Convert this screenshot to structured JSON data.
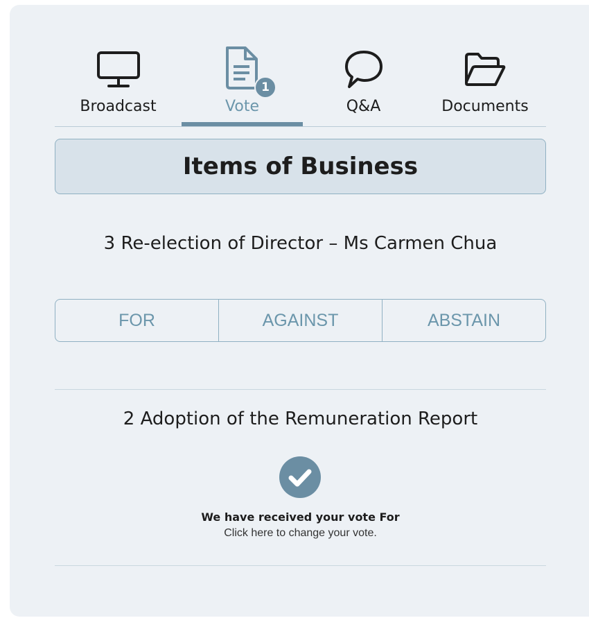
{
  "tabs": [
    {
      "label": "Broadcast",
      "icon": "monitor-icon"
    },
    {
      "label": "Vote",
      "icon": "document-icon",
      "badge": "1",
      "active": true
    },
    {
      "label": "Q&A",
      "icon": "speech-bubble-icon"
    },
    {
      "label": "Documents",
      "icon": "folder-icon"
    }
  ],
  "header": {
    "title": "Items of Business"
  },
  "item_current": {
    "title": "3 Re-election of Director – Ms Carmen Chua",
    "options": [
      "FOR",
      "AGAINST",
      "ABSTAIN"
    ]
  },
  "item_done": {
    "title": "2 Adoption of the Remuneration Report",
    "received_prefix": "We have received your vote ",
    "received_vote": "For",
    "change_text": "Click here to change your vote."
  },
  "colors": {
    "accent": "#6b8ea3",
    "panel": "#edf1f5",
    "header_bg": "#d8e2ea"
  }
}
